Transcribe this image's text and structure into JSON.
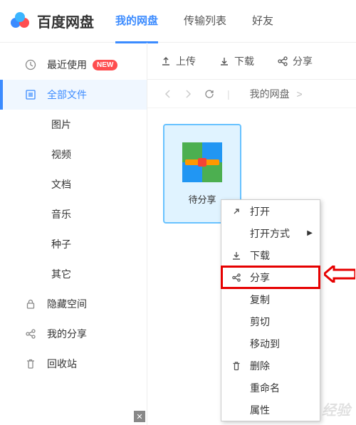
{
  "header": {
    "appName": "百度网盘",
    "tabs": [
      "我的网盘",
      "传输列表",
      "好友"
    ]
  },
  "sidebar": [
    {
      "label": "最近使用",
      "badge": "NEW"
    },
    {
      "label": "全部文件"
    },
    {
      "label": "图片"
    },
    {
      "label": "视频"
    },
    {
      "label": "文档"
    },
    {
      "label": "音乐"
    },
    {
      "label": "种子"
    },
    {
      "label": "其它"
    },
    {
      "label": "隐藏空间"
    },
    {
      "label": "我的分享"
    },
    {
      "label": "回收站"
    }
  ],
  "toolbar": [
    "上传",
    "下载",
    "分享"
  ],
  "breadcrumb": [
    "我的网盘"
  ],
  "files": [
    {
      "name": "待分享",
      "type": "archive",
      "selected": true
    }
  ],
  "contextMenu": [
    {
      "label": "打开",
      "icon": "open"
    },
    {
      "label": "打开方式",
      "submenu": true
    },
    {
      "label": "下载",
      "icon": "download"
    },
    {
      "label": "分享",
      "icon": "share",
      "highlighted": true
    },
    {
      "label": "复制"
    },
    {
      "label": "剪切"
    },
    {
      "label": "移动到"
    },
    {
      "label": "删除",
      "icon": "trash"
    },
    {
      "label": "重命名"
    },
    {
      "label": "属性"
    }
  ],
  "watermark": "Baidu 经验"
}
